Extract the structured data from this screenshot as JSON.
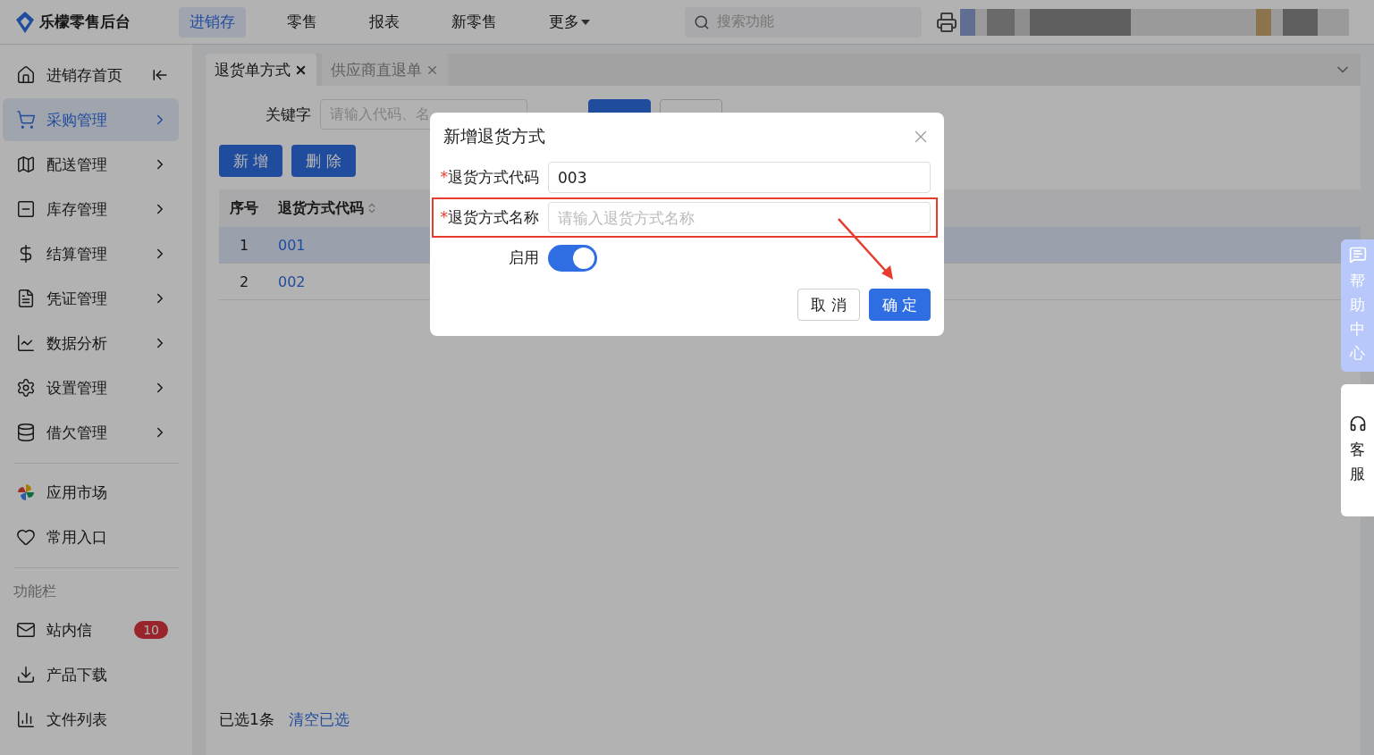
{
  "header": {
    "logo": "乐檬零售后台",
    "nav": [
      {
        "label": "进销存",
        "selected": true
      },
      {
        "label": "零售",
        "selected": false
      },
      {
        "label": "报表",
        "selected": false
      },
      {
        "label": "新零售",
        "selected": false
      },
      {
        "label": "更多",
        "selected": false
      }
    ],
    "search": {
      "placeholder": "搜索功能"
    }
  },
  "sidebar": {
    "items": [
      {
        "label": "进销存首页",
        "selected": false
      },
      {
        "label": "采购管理",
        "selected": true
      },
      {
        "label": "配送管理",
        "selected": false
      },
      {
        "label": "库存管理",
        "selected": false
      },
      {
        "label": "结算管理",
        "selected": false
      },
      {
        "label": "凭证管理",
        "selected": false
      },
      {
        "label": "数据分析",
        "selected": false
      },
      {
        "label": "设置管理",
        "selected": false
      },
      {
        "label": "借欠管理",
        "selected": false
      }
    ],
    "extras": [
      {
        "label": "应用市场"
      },
      {
        "label": "常用入口"
      }
    ],
    "section_title": "功能栏",
    "tools": [
      {
        "label": "站内信",
        "badge": "10"
      },
      {
        "label": "产品下载"
      },
      {
        "label": "文件列表"
      }
    ]
  },
  "tabs": [
    {
      "label": "退货单方式",
      "selected": true
    },
    {
      "label": "供应商直退单",
      "selected": false
    }
  ],
  "filter": {
    "label": "关键字",
    "placeholder": "请输入代码、名"
  },
  "actions": [
    "新 增",
    "删 除"
  ],
  "table": {
    "columns": [
      "序号",
      "退货方式代码"
    ],
    "rows": [
      {
        "index": "1",
        "code": "001",
        "selected": true
      },
      {
        "index": "2",
        "code": "002",
        "selected": false
      }
    ]
  },
  "footer": {
    "selected_count": "已选1条",
    "clear": "清空已选"
  },
  "dialog": {
    "title": "新增退货方式",
    "fields": [
      {
        "required_mark": "*",
        "label": "退货方式代码",
        "value": "003",
        "highlighted": false
      },
      {
        "required_mark": "*",
        "label": "退货方式名称",
        "placeholder": "请输入退货方式名称",
        "highlighted": true
      }
    ],
    "switch": {
      "label": "启用",
      "on": true
    },
    "buttons": [
      {
        "label": "取 消",
        "kind": "default"
      },
      {
        "label": "确 定",
        "kind": "primary"
      }
    ],
    "annotation_arrow": true
  },
  "help": {
    "help_center": "帮助中心",
    "service": "客服"
  }
}
